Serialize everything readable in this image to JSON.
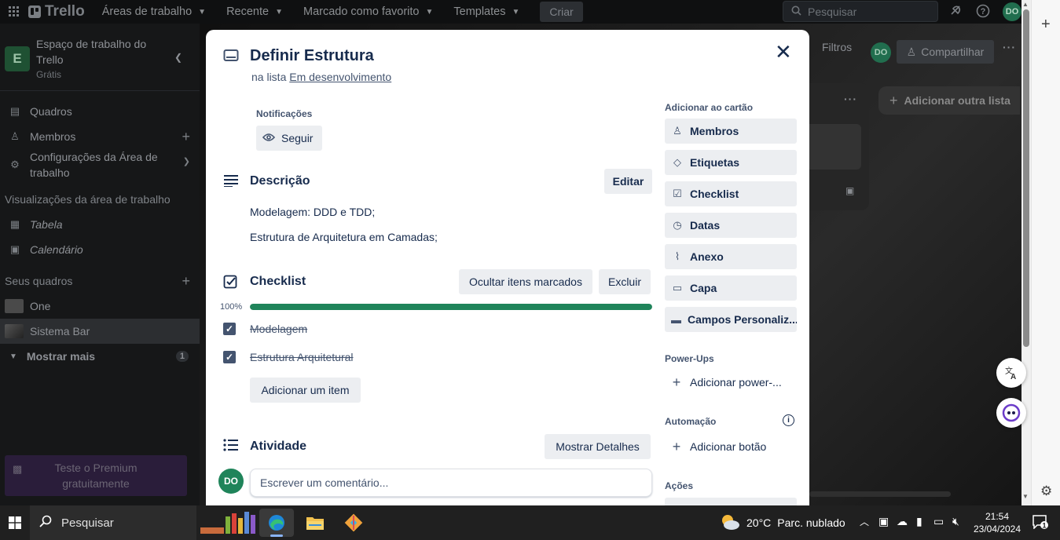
{
  "topnav": {
    "logo": "Trello",
    "items": [
      "Áreas de trabalho",
      "Recente",
      "Marcado como favorito",
      "Templates"
    ],
    "create": "Criar",
    "search_placeholder": "Pesquisar",
    "avatar": "DO"
  },
  "sidebar": {
    "workspace_badge": "E",
    "workspace_name": "Espaço de trabalho do Trello",
    "workspace_plan": "Grátis",
    "items": [
      {
        "label": "Quadros",
        "icon": "board-icon"
      },
      {
        "label": "Membros",
        "icon": "person-icon"
      },
      {
        "label": "Configurações da Área de trabalho",
        "icon": "gear-icon"
      }
    ],
    "views_title": "Visualizações da área de trabalho",
    "views": [
      {
        "label": "Tabela",
        "icon": "table-icon"
      },
      {
        "label": "Calendário",
        "icon": "calendar-icon"
      }
    ],
    "boards_title": "Seus quadros",
    "boards": [
      "One",
      "Sistema Bar"
    ],
    "show_more": "Mostrar mais",
    "show_more_count": "1",
    "premium": "Teste o Premium gratuitamente"
  },
  "board": {
    "filters": "Filtros",
    "avatar": "DO",
    "share": "Compartilhar",
    "add_list": "Adicionar outra lista"
  },
  "card": {
    "title": "Definir Estrutura",
    "list_prefix": "na lista",
    "list_name": "Em desenvolvimento",
    "notifications_label": "Notificações",
    "follow": "Seguir",
    "description_title": "Descrição",
    "edit": "Editar",
    "description_lines": [
      "Modelagem: DDD e TDD;",
      "Estrutura de Arquitetura em Camadas;"
    ],
    "checklist_title": "Checklist",
    "hide_checked": "Ocultar itens marcados",
    "delete": "Excluir",
    "progress_label": "100%",
    "progress_fraction": 1.0,
    "checklist_items": [
      "Modelagem",
      "Estrutura Arquitetural"
    ],
    "add_item": "Adicionar um item",
    "activity_title": "Atividade",
    "show_details": "Mostrar Detalhes",
    "commenter_avatar": "DO",
    "comment_placeholder": "Escrever um comentário..."
  },
  "card_sidebar": {
    "add_to_card": "Adicionar ao cartão",
    "buttons": [
      {
        "label": "Membros",
        "icon": "person-icon"
      },
      {
        "label": "Etiquetas",
        "icon": "tag-icon"
      },
      {
        "label": "Checklist",
        "icon": "checklist-icon"
      },
      {
        "label": "Datas",
        "icon": "clock-icon"
      },
      {
        "label": "Anexo",
        "icon": "paperclip-icon"
      },
      {
        "label": "Capa",
        "icon": "cover-icon"
      },
      {
        "label": "Campos Personaliz...",
        "icon": "fields-icon"
      }
    ],
    "powerups_title": "Power-Ups",
    "add_powerup": "Adicionar power-...",
    "automation_title": "Automação",
    "add_button": "Adicionar botão",
    "actions_title": "Ações"
  },
  "taskbar": {
    "search": "Pesquisar",
    "temperature": "20°C",
    "weather": "Parc. nublado",
    "time": "21:54",
    "date": "23/04/2024",
    "notification_count": "1"
  }
}
